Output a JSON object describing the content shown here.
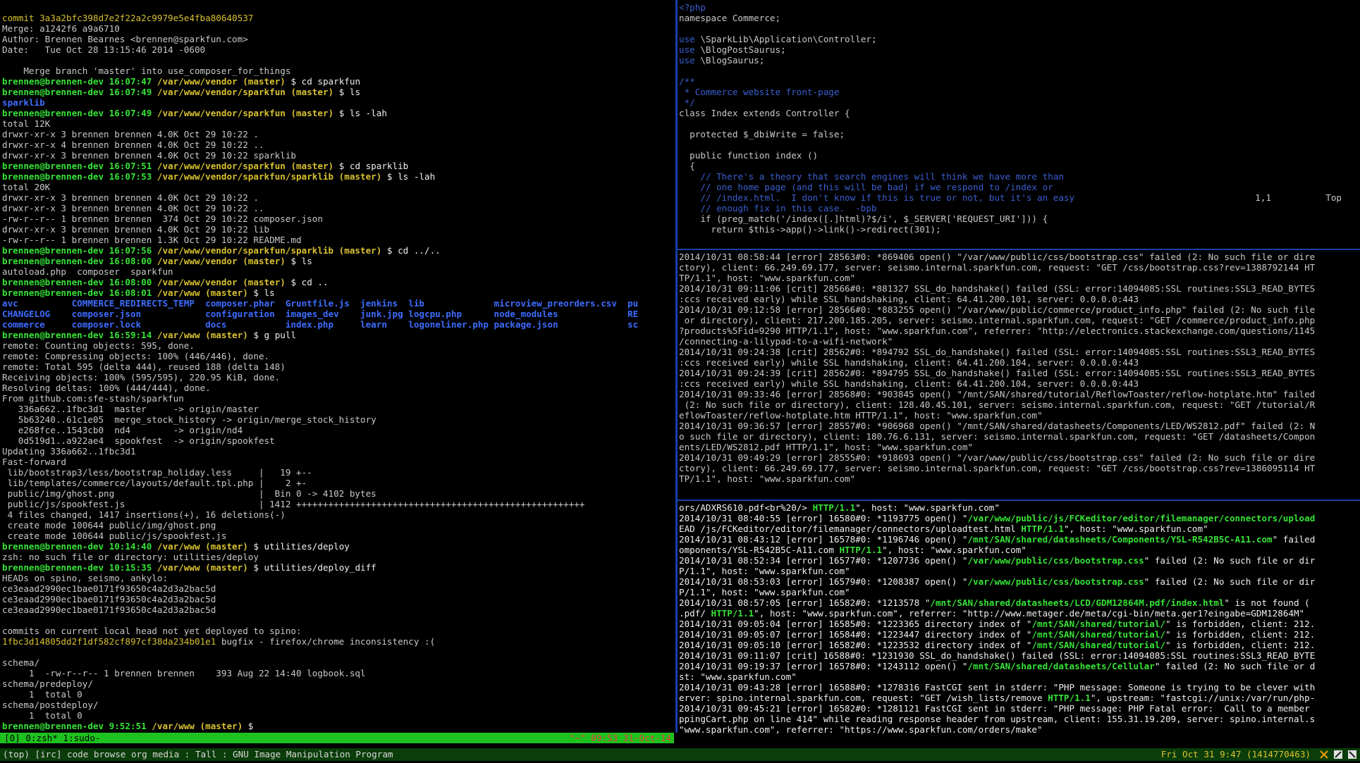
{
  "terminal_left": {
    "lines": [
      "commit 3a3a2bfc398d7e2f22a2c9979e5e4fba80640537",
      "Merge: a1242f6 a9a6710",
      "Author: Brennen Bearnes <brennen@sparkfun.com>",
      "Date:   Tue Oct 28 13:15:46 2014 -0600",
      "",
      "    Merge branch 'master' into use_composer_for_things",
      "brennen@brennen-dev 16:07:47 /var/www/vendor (master) $ cd sparkfun",
      "brennen@brennen-dev 16:07:49 /var/www/vendor/sparkfun (master) $ ls",
      "sparklib",
      "brennen@brennen-dev 16:07:49 /var/www/vendor/sparkfun (master) $ ls -lah",
      "total 12K",
      "drwxr-xr-x 3 brennen brennen 4.0K Oct 29 10:22 .",
      "drwxr-xr-x 4 brennen brennen 4.0K Oct 29 10:22 ..",
      "drwxr-xr-x 3 brennen brennen 4.0K Oct 29 10:22 sparklib",
      "brennen@brennen-dev 16:07:51 /var/www/vendor/sparkfun (master) $ cd sparklib",
      "brennen@brennen-dev 16:07:53 /var/www/vendor/sparkfun/sparklib (master) $ ls -lah",
      "total 20K",
      "drwxr-xr-x 3 brennen brennen 4.0K Oct 29 10:22 .",
      "drwxr-xr-x 3 brennen brennen 4.0K Oct 29 10:22 ..",
      "-rw-r--r-- 1 brennen brennen  374 Oct 29 10:22 composer.json",
      "drwxr-xr-x 3 brennen brennen 4.0K Oct 29 10:22 lib",
      "-rw-r--r-- 1 brennen brennen 1.3K Oct 29 10:22 README.md",
      "brennen@brennen-dev 16:07:56 /var/www/vendor/sparkfun/sparklib (master) $ cd ../..",
      "brennen@brennen-dev 16:08:00 /var/www/vendor (master) $ ls",
      "autoload.php  composer  sparkfun",
      "brennen@brennen-dev 16:08:00 /var/www/vendor (master) $ cd ..",
      "brennen@brennen-dev 16:08:01 /var/www (master) $ ls",
      "avc          COMMERCE_REDIRECTS_TEMP  composer.phar  Gruntfile.js  jenkins  lib             microview_preorders.csv  pu",
      "CHANGELOG    composer.json            configuration  images_dev    junk.jpg logcpu.php      node_modules             RE",
      "commerce     composer.lock            docs           index.php     learn    logoneliner.php package.json             sc",
      "brennen@brennen-dev 16:59:14 /var/www (master) $ g pull",
      "remote: Counting objects: 595, done.",
      "remote: Compressing objects: 100% (446/446), done.",
      "remote: Total 595 (delta 444), reused 188 (delta 148)",
      "Receiving objects: 100% (595/595), 220.95 KiB, done.",
      "Resolving deltas: 100% (444/444), done.",
      "From github.com:sfe-stash/sparkfun",
      "   336a662..1fbc3d1  master     -> origin/master",
      "   5b63240..61c1e05  merge_stock_history -> origin/merge_stock_history",
      "   e268fce..1543cb0  nd4        -> origin/nd4",
      "   0d519d1..a922ae4  spookfest  -> origin/spookfest",
      "Updating 336a662..1fbc3d1",
      "Fast-forward",
      " lib/bootstrap3/less/bootstrap_holiday.less     |   19 +--",
      " lib/templates/commerce/layouts/default.tpl.php |    2 +-",
      " public/img/ghost.png                           |  Bin 0 -> 4102 bytes",
      " public/js/spookfest.js                         | 1412 ++++++++++++++++++++++++++++++++++++++++++++++++++++++",
      " 4 files changed, 1417 insertions(+), 16 deletions(-)",
      " create mode 100644 public/img/ghost.png",
      " create mode 100644 public/js/spookfest.js",
      "brennen@brennen-dev 10:14:40 /var/www (master) $ utilities/deploy",
      "zsh: no such file or directory: utilities/deploy",
      "brennen@brennen-dev 10:15:35 /var/www (master) $ utilities/deploy_diff",
      "HEADs on spino, seismo, ankylo:",
      "ce3eaad2990ec1bae0171f93650c4a2d3a2bac5d",
      "ce3eaad2990ec1bae0171f93650c4a2d3a2bac5d",
      "ce3eaad2990ec1bae0171f93650c4a2d3a2bac5d",
      "",
      "commits on current local head not yet deployed to spino:",
      "1fbc3d14805dd2f1df582cf897cf38da234b01e1 bugfix - firefox/chrome inconsistency :(",
      "",
      "schema/",
      "     1  -rw-r--r-- 1 brennen brennen    393 Aug 22 14:40 logbook.sql",
      "schema/predeploy/",
      "     1  total 0",
      "schema/postdeploy/",
      "     1  total 0",
      "brennen@brennen-dev 9:52:51 /var/www (master) $ "
    ]
  },
  "tmux_status": {
    "left": "[0] 0:zsh* 1:sudo-",
    "right": "\"~\" 09:53 31-Oct-14"
  },
  "vim": {
    "lines": [
      "<?php",
      "namespace Commerce;",
      "",
      "use \\SparkLib\\Application\\Controller;",
      "use \\BlogPostSaurus;",
      "use \\BlogSaurus;",
      "",
      "/**",
      " * Commerce website front-page",
      " */",
      "class Index extends Controller {",
      "",
      "  protected $_dbiWrite = false;",
      "",
      "  public function index ()",
      "  {",
      "    // There's a theory that search engines will think we have more than",
      "    // one home page (and this will be bad) if we respond to /index or",
      "    // /index.html.  I don't know if this is true or not, but it's an easy",
      "    // enough fix in this case.  -bpb",
      "    if (preg_match('/index([.]html)?$/i', $_SERVER['REQUEST_URI'])) {",
      "      return $this->app()->link()->redirect(301);"
    ],
    "ruler": "1,1",
    "position": "Top"
  },
  "log_a": {
    "lines": [
      "2014/10/31 08:58:44 [error] 28563#0: *869406 open() \"/var/www/public/css/bootstrap.css\" failed (2: No such file or dire",
      "ctory), client: 66.249.69.177, server: seismo.internal.sparkfun.com, request: \"GET /css/bootstrap.css?rev=1388792144 HT",
      "TP/1.1\", host: \"www.sparkfun.com\"",
      "2014/10/31 09:11:06 [crit] 28566#0: *881327 SSL_do_handshake() failed (SSL: error:14094085:SSL routines:SSL3_READ_BYTES",
      ":ccs received early) while SSL handshaking, client: 64.41.200.101, server: 0.0.0.0:443",
      "2014/10/31 09:12:58 [error] 28566#0: *883255 open() \"/var/www/public/commerce/product_info.php\" failed (2: No such file",
      " or directory), client: 217.200.185.205, server: seismo.internal.sparkfun.com, request: \"GET /commerce/product_info.php",
      "?products%5Fid=9290 HTTP/1.1\", host: \"www.sparkfun.com\", referrer: \"http://electronics.stackexchange.com/questions/1145",
      "/connecting-a-lilypad-to-a-wifi-network\"",
      "2014/10/31 09:24:38 [crit] 28562#0: *894792 SSL_do_handshake() failed (SSL: error:14094085:SSL routines:SSL3_READ_BYTES",
      ":ccs received early) while SSL handshaking, client: 64.41.200.104, server: 0.0.0.0:443",
      "2014/10/31 09:24:39 [crit] 28562#0: *894795 SSL_do_handshake() failed (SSL: error:14094085:SSL routines:SSL3_READ_BYTES",
      ":ccs received early) while SSL handshaking, client: 64.41.200.104, server: 0.0.0.0:443",
      "2014/10/31 09:33:46 [error] 28568#0: *903845 open() \"/mnt/SAN/shared/tutorial/ReflowToaster/reflow-hotplate.htm\" failed",
      " (2: No such file or directory), client: 128.40.45.101, server: seismo.internal.sparkfun.com, request: \"GET /tutorial/R",
      "eflowToaster/reflow-hotplate.htm HTTP/1.1\", host: \"www.sparkfun.com\"",
      "2014/10/31 09:36:57 [error] 28557#0: *906968 open() \"/mnt/SAN/shared/datasheets/Components/LED/WS2812.pdf\" failed (2: N",
      "o such file or directory), client: 180.76.6.131, server: seismo.internal.sparkfun.com, request: \"GET /datasheets/Compon",
      "ents/LED/WS2812.pdf HTTP/1.1\", host: \"www.sparkfun.com\"",
      "2014/10/31 09:49:29 [error] 28555#0: *918693 open() \"/var/www/public/css/bootstrap.css\" failed (2: No such file or dire",
      "ctory), client: 66.249.69.177, server: seismo.internal.sparkfun.com, request: \"GET /css/bootstrap.css?rev=1386095114 HT",
      "TP/1.1\", host: \"www.sparkfun.com\"",
      ""
    ]
  },
  "log_b": {
    "lines": [
      "ors/ADXRS610.pdf<br%20/> HTTP/1.1\", host: \"www.sparkfun.com\"",
      "2014/10/31 08:40:55 [error] 16580#0: *1193775 open() \"/var/www/public/js/FCKeditor/editor/filemanager/connectors/upload",
      "EAD /js/FCKeditor/editor/filemanager/connectors/uploadtest.html HTTP/1.1\", host: \"www.sparkfun.com\"",
      "2014/10/31 08:43:12 [error] 16578#0: *1196746 open() \"/mnt/SAN/shared/datasheets/Components/YSL-R542B5C-A11.com\" failed",
      "omponents/YSL-R542B5C-A11.com HTTP/1.1\", host: \"www.sparkfun.com\"",
      "2014/10/31 08:52:34 [error] 16577#0: *1207736 open() \"/var/www/public/css/bootstrap.css\" failed (2: No such file or dir",
      "P/1.1\", host: \"www.sparkfun.com\"",
      "2014/10/31 08:53:03 [error] 16579#0: *1208387 open() \"/var/www/public/css/bootstrap.css\" failed (2: No such file or dir",
      "P/1.1\", host: \"www.sparkfun.com\"",
      "2014/10/31 08:57:05 [error] 16582#0: *1213578 \"/mnt/SAN/shared/datasheets/LCD/GDM12864M.pdf/index.html\" is not found (",
      ".pdf/ HTTP/1.1\", host: \"www.sparkfun.com\", referrer: \"http://www.metager.de/meta/cgi-bin/meta.ger1?eingabe=GDM12864M\"",
      "2014/10/31 09:05:04 [error] 16585#0: *1223365 directory index of \"/mnt/SAN/shared/tutorial/\" is forbidden, client: 212.",
      "2014/10/31 09:05:07 [error] 16584#0: *1223447 directory index of \"/mnt/SAN/shared/tutorial/\" is forbidden, client: 212.",
      "2014/10/31 09:05:10 [error] 16582#0: *1223532 directory index of \"/mnt/SAN/shared/tutorial/\" is forbidden, client: 212.",
      "2014/10/31 09:11:07 [crit] 16588#0: *1231930 SSL_do_handshake() failed (SSL: error:14094085:SSL routines:SSL3_READ_BYTE",
      "2014/10/31 09:19:37 [error] 16578#0: *1243112 open() \"/mnt/SAN/shared/datasheets/Cellular\" failed (2: No such file or d",
      "st: \"www.sparkfun.com\"",
      "2014/10/31 09:43:28 [error] 16588#0: *1278316 FastCGI sent in stderr: \"PHP message: Someone is trying to be clever with",
      "erver: spino.internal.sparkfun.com, request: \"GET /wish_lists/remove HTTP/1.1\", upstream: \"fastcgi://unix:/var/run/php-",
      "2014/10/31 09:45:21 [error] 16582#0: *1281121 FastCGI sent in stderr: \"PHP message: PHP Fatal error:  Call to a member",
      "ppingCart.php on line 414\" while reading response header from upstream, client: 155.31.19.209, server: spino.internal.s",
      "\"www.sparkfun.com\", referrer: \"https://www.sparkfun.com/orders/make\"",
      ""
    ]
  },
  "bottom_bar": {
    "left": "(top) [irc] code browse org media : Tall : GNU Image Manipulation Program",
    "right": "Fri Oct 31  9:47 (1414770463)"
  },
  "colors": {
    "prompt_green": "#36e336",
    "path_yellow": "#d7c030",
    "dir_blue": "#3d6cff",
    "separator": "#1a3fa8",
    "tmux_bar": "#1ec21e"
  }
}
